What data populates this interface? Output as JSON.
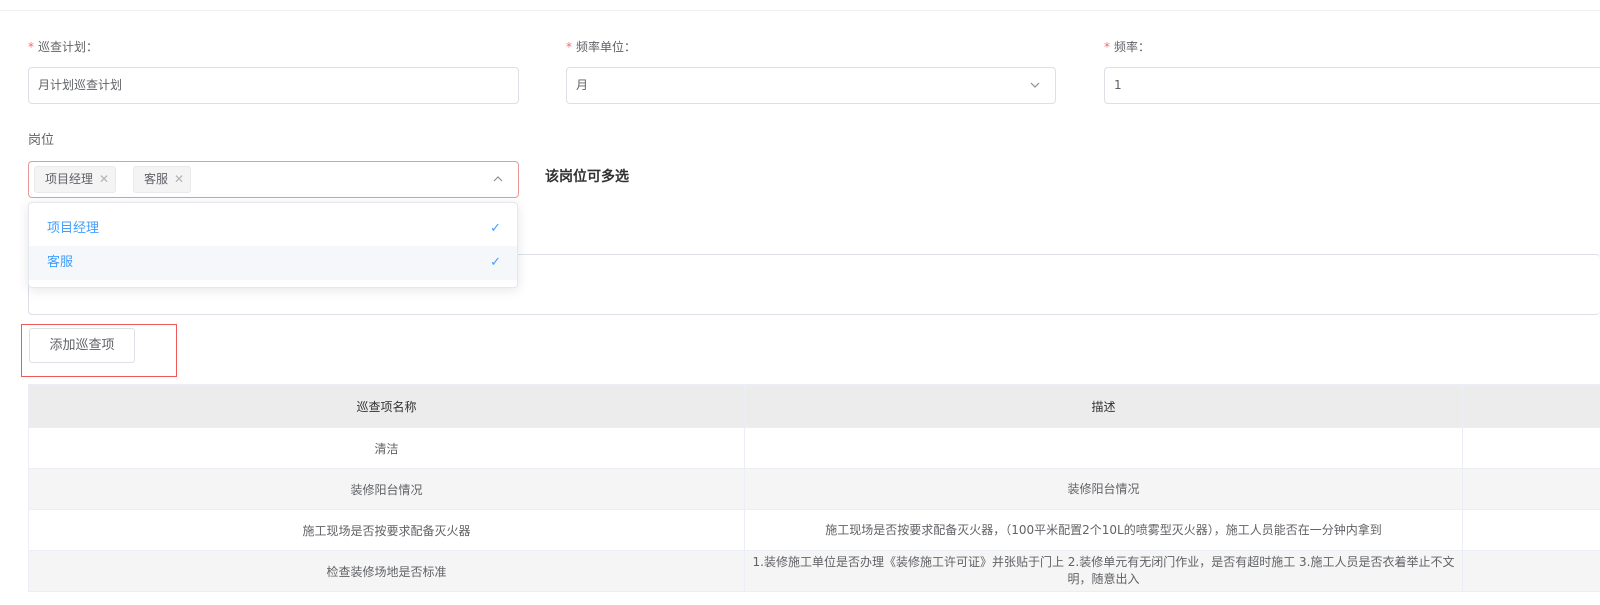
{
  "form": {
    "plan": {
      "required_mark": "*",
      "label": "巡查计划：",
      "value": "月计划巡查计划"
    },
    "unit": {
      "required_mark": "*",
      "label": "频率单位：",
      "value": "月"
    },
    "freq": {
      "required_mark": "*",
      "label": "频率：",
      "value": "1"
    },
    "post": {
      "label": "岗位",
      "tags": [
        "项目经理",
        "客服"
      ],
      "hint": "该岗位可多选",
      "options": [
        "项目经理",
        "客服"
      ]
    },
    "add_button": "添加巡查项"
  },
  "table": {
    "columns": [
      "巡查项名称",
      "描述",
      ""
    ],
    "rows": [
      {
        "name": "清洁",
        "desc": ""
      },
      {
        "name": "装修阳台情况",
        "desc": "装修阳台情况"
      },
      {
        "name": "施工现场是否按要求配备灭火器",
        "desc": "施工现场是否按要求配备灭火器，（100平米配置2个10L的喷雾型灭火器），施工人员能否在一分钟内拿到"
      },
      {
        "name": "检查装修场地是否标准",
        "desc": "1.装修施工单位是否办理《装修施工许可证》并张贴于门上 2.装修单元有无闭门作业，是否有超时施工 3.施工人员是否衣着举止不文明，随意出入"
      }
    ]
  },
  "colors": {
    "required": "#f56c6c",
    "accent": "#409eff",
    "highlight": "#ee5a5a"
  }
}
